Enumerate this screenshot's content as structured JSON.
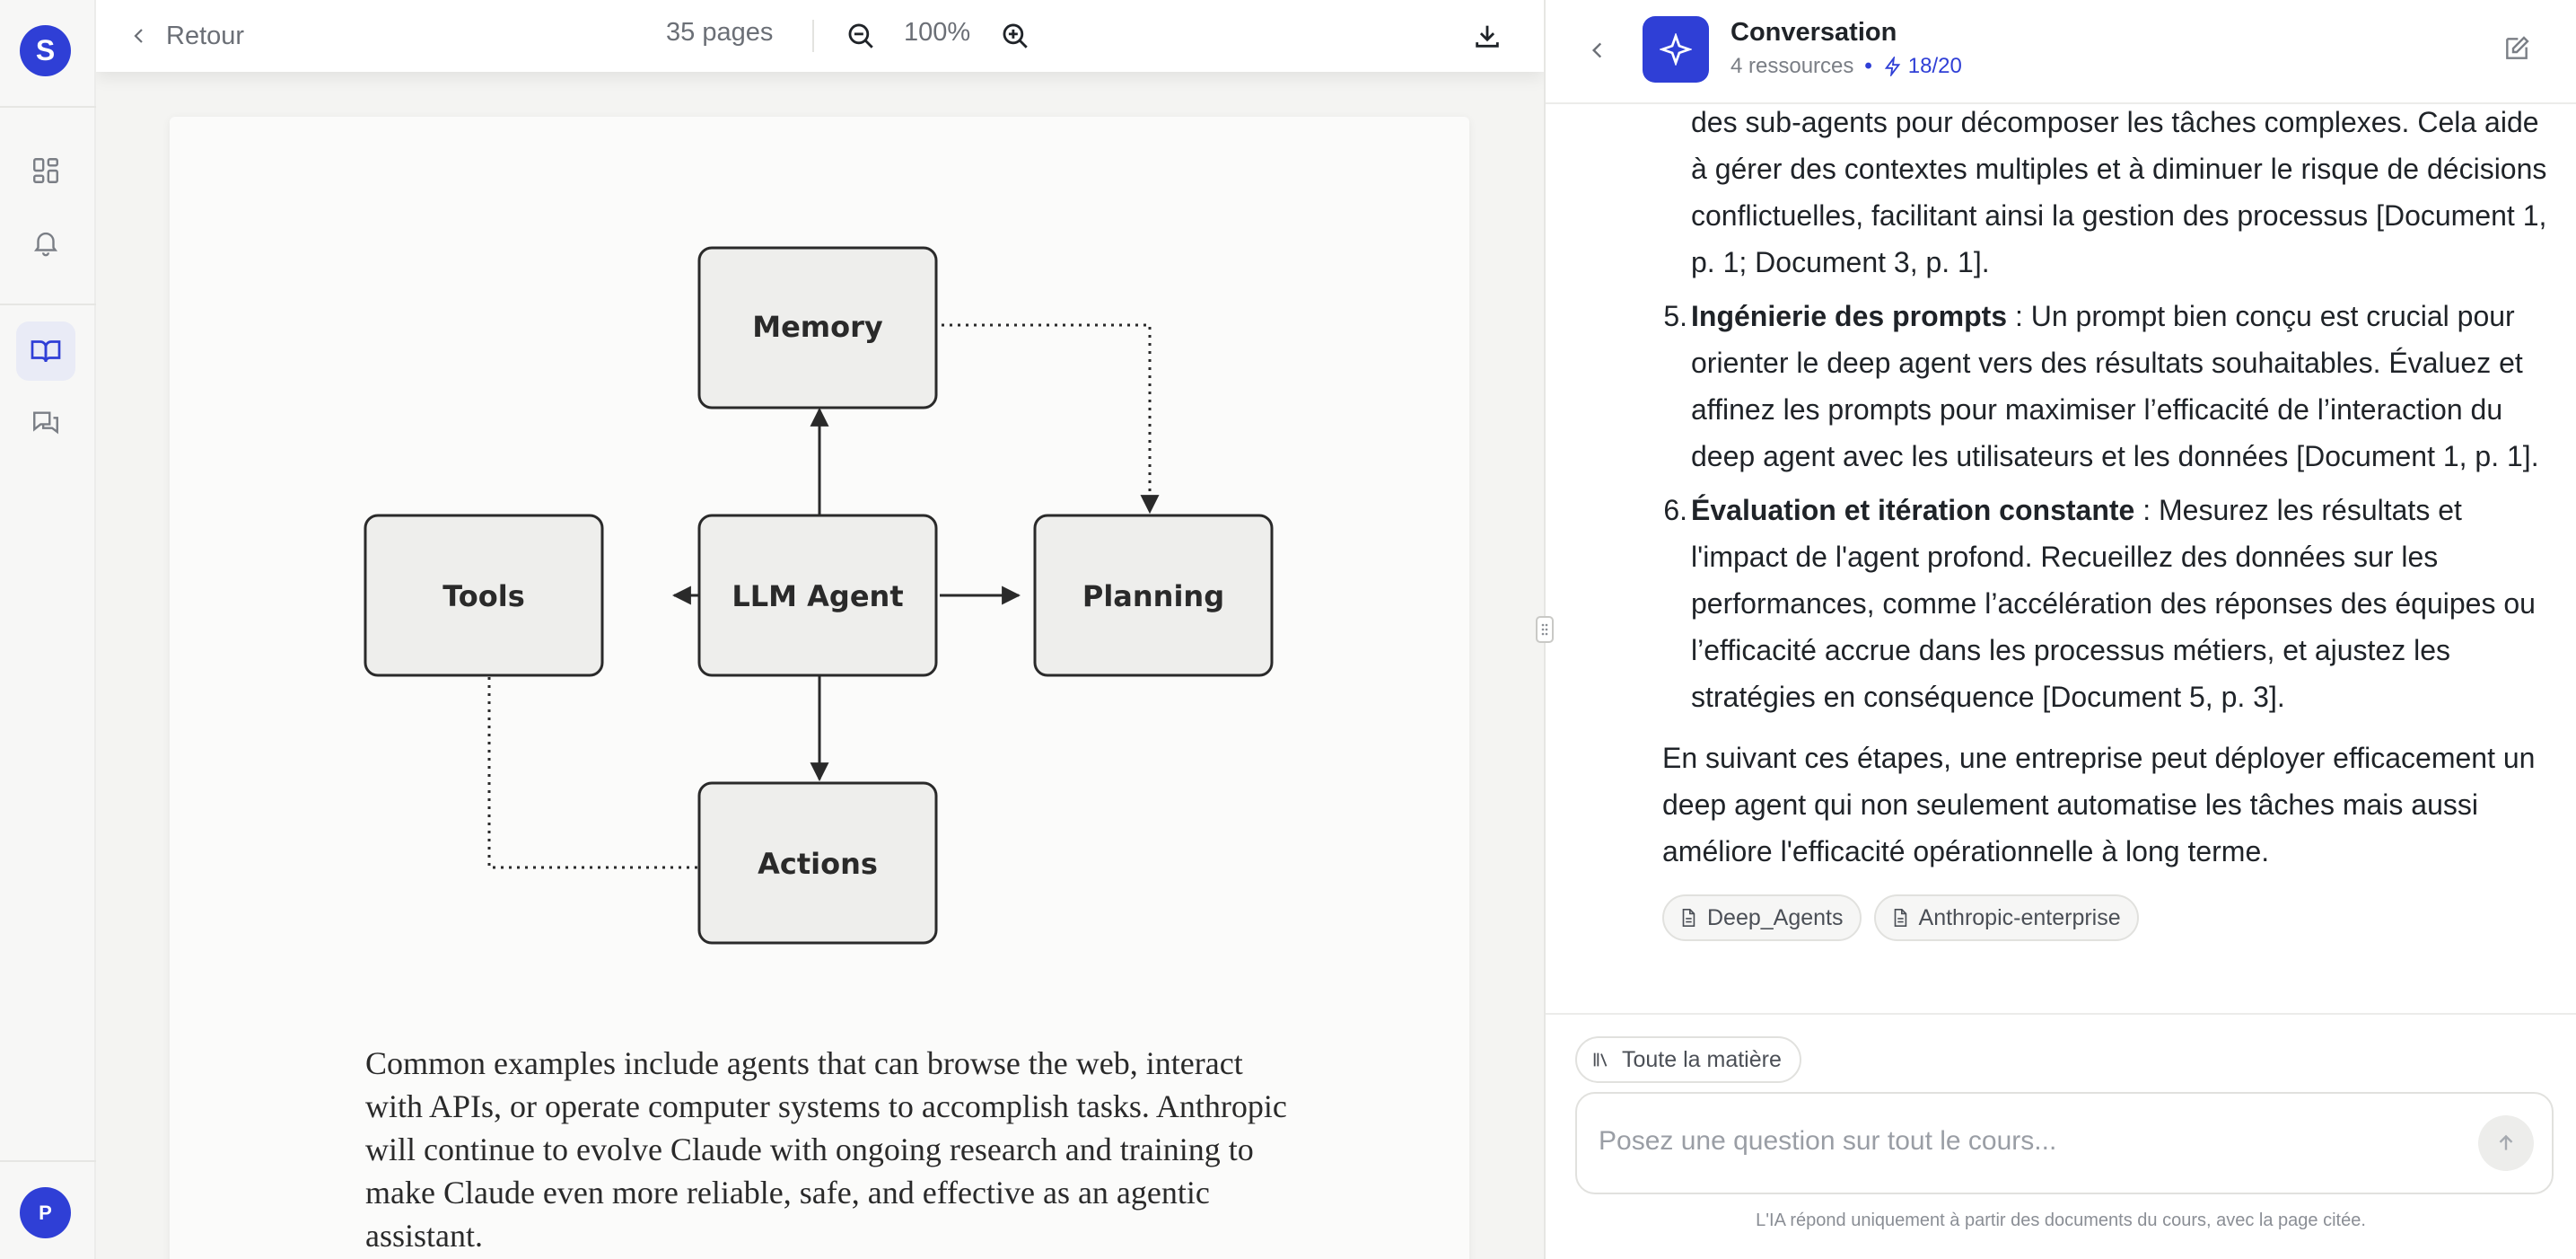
{
  "rail": {
    "logo": "S",
    "avatar": "P"
  },
  "viewer": {
    "back_label": "Retour",
    "page_count": "35 pages",
    "zoom": "100%",
    "diagram": {
      "memory": "Memory",
      "tools": "Tools",
      "agent": "LLM Agent",
      "planning": "Planning",
      "actions": "Actions"
    },
    "page_text": "Common examples include agents that can browse the web, interact with APIs, or operate computer systems to accomplish tasks. Anthropic will continue to evolve Claude with ongoing research and training to make Claude even more reliable, safe, and effective as an agentic assistant."
  },
  "chat": {
    "title": "Conversation",
    "resources": "4 ressources",
    "credits": "18/20",
    "continuation": "des sub-agents pour décomposer les tâches complexes. Cela aide à gérer des contextes multiples et à diminuer le risque de décisions conflictuelles, facilitant ainsi la gestion des processus [Document 1, p. 1; Document 3, p. 1].",
    "items": [
      {
        "num": "5.",
        "heading": "Ingénierie des prompts",
        "text": " : Un prompt bien conçu est crucial pour orienter le deep agent vers des résultats souhaitables. Évaluez et affinez les prompts pour maximiser l’efficacité de l’interaction du deep agent avec les utilisateurs et les données [Document 1, p. 1]."
      },
      {
        "num": "6.",
        "heading": "Évaluation et itération constante",
        "text": " : Mesurez les résultats et l'impact de l'agent profond. Recueillez des données sur les performances, comme l’accélération des réponses des équipes ou l’efficacité accrue dans les processus métiers, et ajustez les stratégies en conséquence [Document 5, p. 3]."
      }
    ],
    "outro": "En suivant ces étapes, une entreprise peut déployer efficacement un deep agent qui non seulement automatise les tâches mais aussi améliore l'efficacité opérationnelle à long terme.",
    "sources": [
      "Deep_Agents",
      "Anthropic-enterprise"
    ],
    "scope_label": "Toute la matière",
    "input_placeholder": "Posez une question sur tout le cours...",
    "input_value": "",
    "disclaimer": "L'IA répond uniquement à partir des documents du cours, avec la page citée."
  },
  "colors": {
    "accent": "#2f3fd6",
    "rail_bg": "#f7f7f6",
    "viewer_bg": "#f4f4f2"
  }
}
